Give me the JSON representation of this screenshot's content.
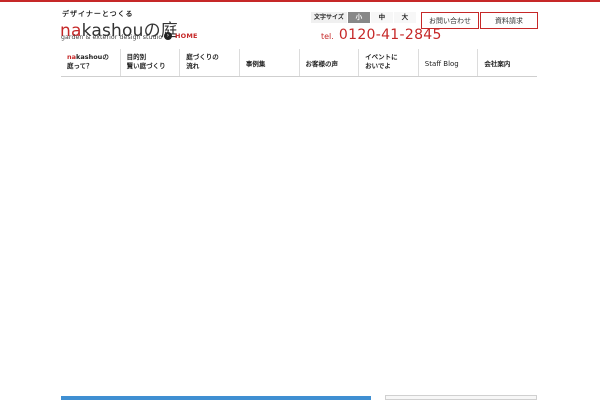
{
  "header": {
    "tagline": "デザイナーとつくる",
    "logo_prefix": "na",
    "logo_main": "kashou",
    "logo_suffix": "の庭",
    "subtitle": "garden & exterior design studio",
    "home_label": "HOME",
    "font_size": {
      "label": "文字サイズ",
      "options": [
        "小",
        "中",
        "大"
      ],
      "selected": "小"
    },
    "tel_label": "tel.",
    "tel_number": "0120-41-2845",
    "contact_button": "お問い合わせ",
    "docs_button": "資料請求"
  },
  "nav": {
    "items": [
      {
        "pre": "na",
        "label": "kashouの\n庭って？"
      },
      {
        "label": "目的別\n賢い庭づくり"
      },
      {
        "label": "庭づくりの\n流れ"
      },
      {
        "label": "事例集"
      },
      {
        "label": "お客様の声"
      },
      {
        "label": "イベントに\nおいでよ"
      },
      {
        "label": "Staff Blog"
      },
      {
        "label": "会社案内"
      }
    ]
  },
  "colors": {
    "accent": "#c62828",
    "blue_strip": "#3f8fd2",
    "font_size_active": "#888888"
  }
}
